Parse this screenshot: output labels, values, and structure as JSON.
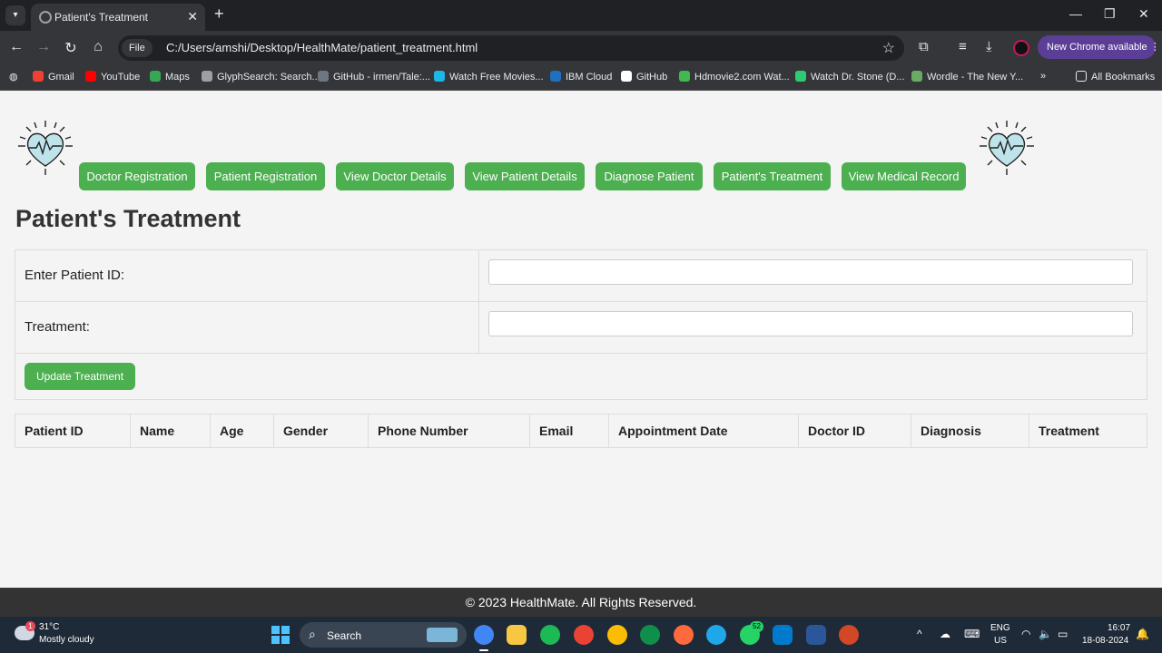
{
  "browser": {
    "tab_title": "Patient's Treatment",
    "url_scheme": "File",
    "url": "C:/Users/amshi/Desktop/HealthMate/patient_treatment.html",
    "update_label": "New Chrome available",
    "bookmarks": [
      {
        "label": "Gmail",
        "color": "#ea4335"
      },
      {
        "label": "YouTube",
        "color": "#ff0000"
      },
      {
        "label": "Maps",
        "color": "#34a853"
      },
      {
        "label": "GlyphSearch: Search...",
        "color": "#9aa0a6"
      },
      {
        "label": "GitHub - irmen/Tale:...",
        "color": "#6e7681"
      },
      {
        "label": "Watch Free Movies...",
        "color": "#1bb7e6"
      },
      {
        "label": "IBM Cloud",
        "color": "#1f70c1"
      },
      {
        "label": "GitHub",
        "color": "#ffffff"
      },
      {
        "label": "Hdmovie2.com Wat...",
        "color": "#3fb950"
      },
      {
        "label": "Watch Dr. Stone (D...",
        "color": "#2ecc71"
      },
      {
        "label": "Wordle - The New Y...",
        "color": "#6aaa64"
      }
    ],
    "all_bookmarks": "All Bookmarks"
  },
  "nav": {
    "buttons": [
      "Doctor Registration",
      "Patient Registration",
      "View Doctor Details",
      "View Patient Details",
      "Diagnose Patient",
      "Patient's Treatment",
      "View Medical Record"
    ]
  },
  "page": {
    "title": "Patient's Treatment",
    "form": {
      "patient_id_label": "Enter Patient ID:",
      "patient_id_value": "",
      "treatment_label": "Treatment:",
      "treatment_value": "",
      "submit_label": "Update Treatment"
    },
    "table": {
      "headers": [
        "Patient ID",
        "Name",
        "Age",
        "Gender",
        "Phone Number",
        "Email",
        "Appointment Date",
        "Doctor ID",
        "Diagnosis",
        "Treatment"
      ]
    },
    "footer": "© 2023 HealthMate. All Rights Reserved."
  },
  "colors": {
    "accent": "#4caf50",
    "footer_bg": "#333333",
    "page_bg": "#f4f4f4"
  },
  "taskbar": {
    "weather_badge": "1",
    "weather_temp": "31°C",
    "weather_desc": "Mostly cloudy",
    "search_label": "Search",
    "whatsapp_badge": "52",
    "lang_line1": "ENG",
    "lang_line2": "US",
    "time": "16:07",
    "date": "18-08-2024"
  }
}
